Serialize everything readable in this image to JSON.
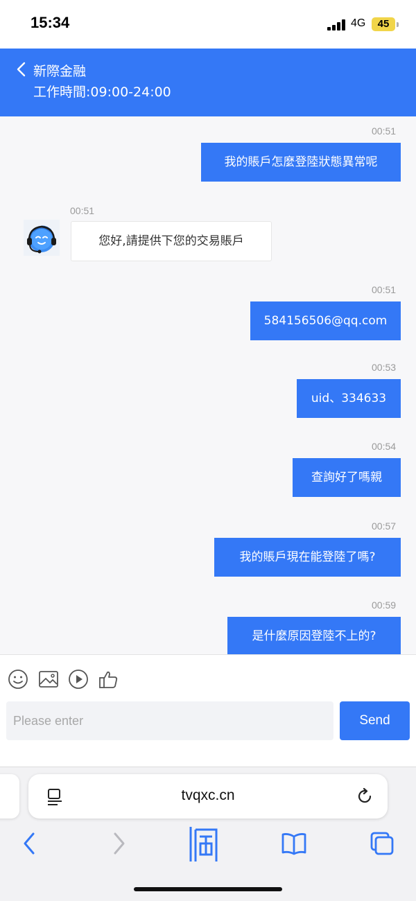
{
  "status_bar": {
    "time": "15:34",
    "network": "4G",
    "battery": "45"
  },
  "header": {
    "title": "新際金融",
    "hours": "工作時間:09:00-24:00"
  },
  "messages": [
    {
      "side": "out",
      "time": "00:51",
      "text": "我的賬戶怎麼登陸狀態異常呢"
    },
    {
      "side": "in",
      "time": "00:51",
      "text": "您好,請提供下您的交易賬戶"
    },
    {
      "side": "out",
      "time": "00:51",
      "text": "584156506@qq.com"
    },
    {
      "side": "out",
      "time": "00:53",
      "text": "uid、334633"
    },
    {
      "side": "out",
      "time": "00:54",
      "text": "查詢好了嗎親"
    },
    {
      "side": "out",
      "time": "00:57",
      "text": "我的賬戶現在能登陸了嗎?"
    },
    {
      "side": "out",
      "time": "00:59",
      "text": "是什麼原因登陸不上的?"
    }
  ],
  "toolbar": {
    "icons": [
      "emoji-icon",
      "image-icon",
      "video-icon",
      "thumbs-up-icon"
    ]
  },
  "input": {
    "placeholder": "Please enter",
    "value": ""
  },
  "send_label": "Send",
  "browser": {
    "url": "tvqxc.cn",
    "icons": [
      "page-menu-icon",
      "reload-icon",
      "back-icon",
      "forward-icon",
      "share-icon",
      "bookmarks-icon",
      "tabs-icon"
    ]
  },
  "colors": {
    "accent": "#3478f6",
    "background": "#f7f7f9",
    "timestamp": "#9a9a9a"
  }
}
